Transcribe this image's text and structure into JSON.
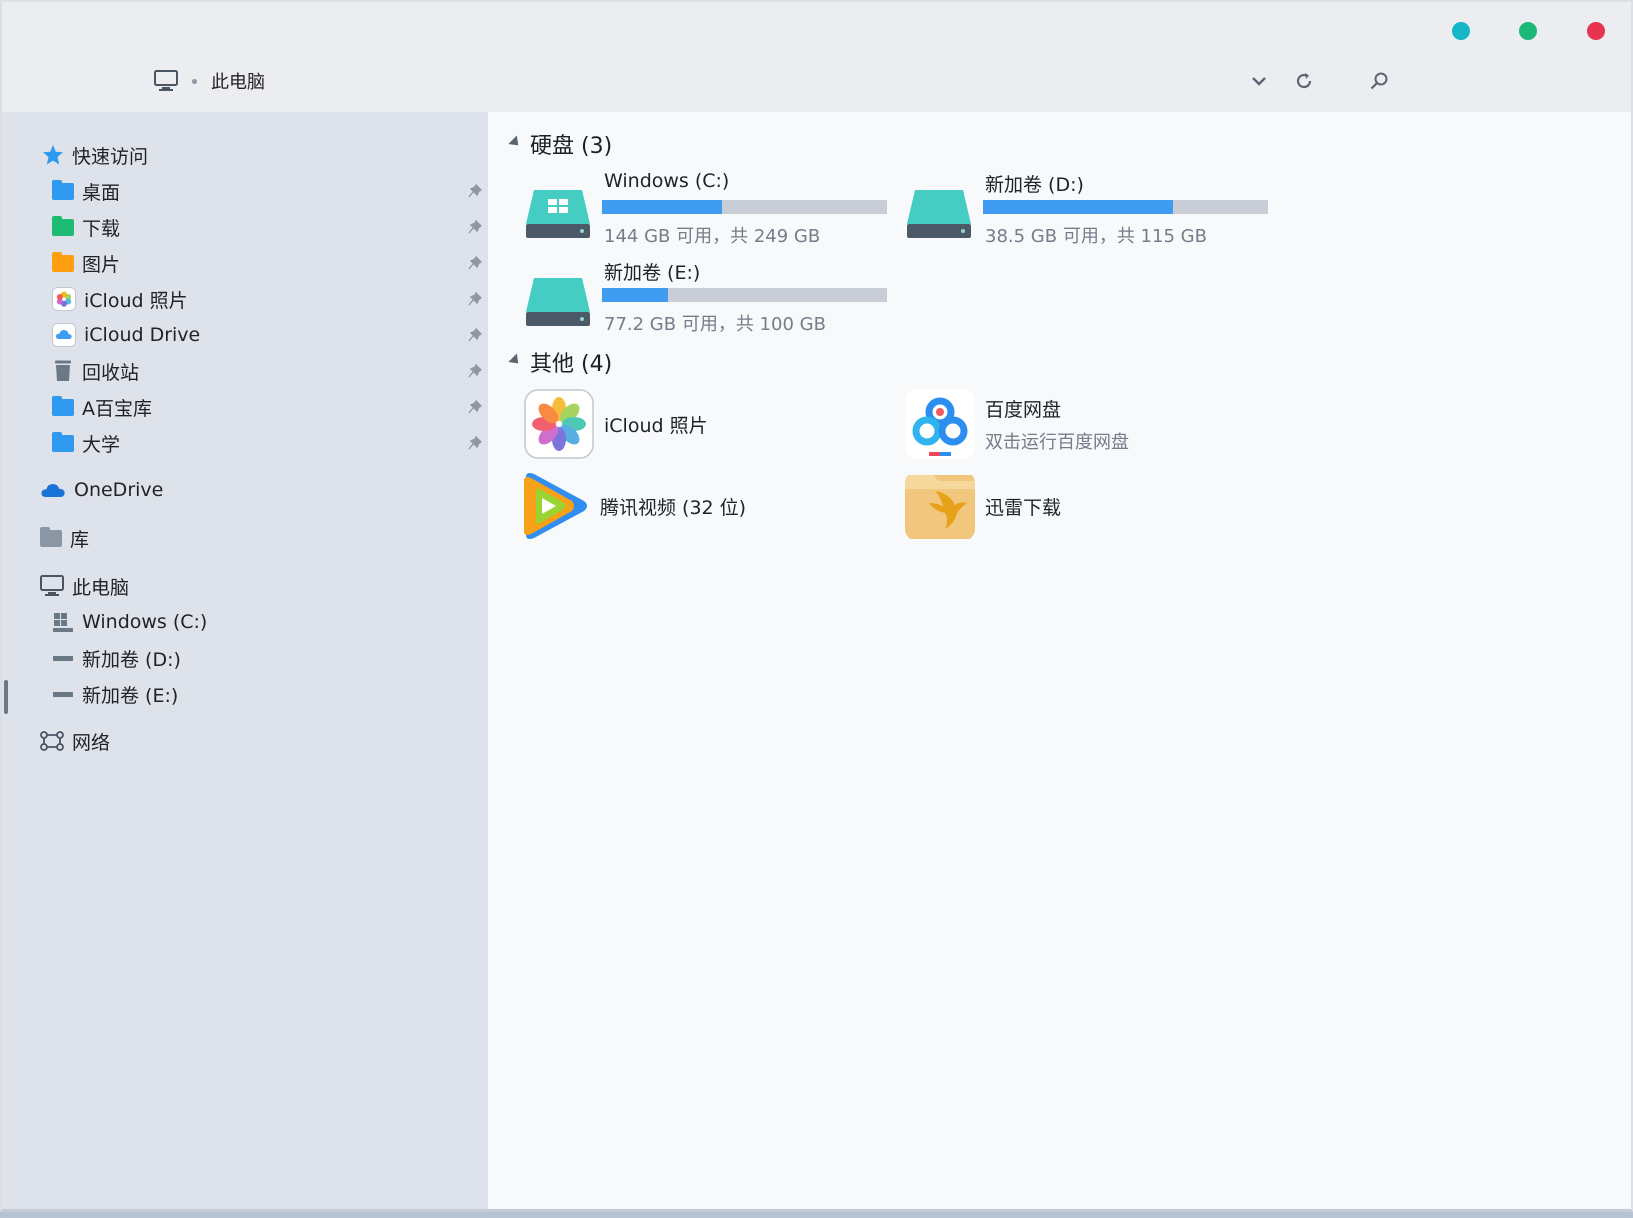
{
  "titlebar": {
    "location_label": "此电脑",
    "buttons": [
      "dropdown",
      "refresh",
      "search"
    ],
    "window_controls": {
      "colors": [
        "#14b6c8",
        "#1cb877",
        "#e8334f"
      ]
    }
  },
  "sidebar": {
    "quick_access": "快速访问",
    "pinned": [
      {
        "label": "桌面",
        "icon": "folder-blue-icon"
      },
      {
        "label": "下载",
        "icon": "folder-green-icon"
      },
      {
        "label": "图片",
        "icon": "folder-orange-icon"
      },
      {
        "label": "iCloud 照片",
        "icon": "icloud-photos-icon"
      },
      {
        "label": "iCloud Drive",
        "icon": "icloud-drive-icon"
      },
      {
        "label": "回收站",
        "icon": "recycle-bin-icon"
      },
      {
        "label": "A百宝库",
        "icon": "folder-blue-icon"
      },
      {
        "label": "大学",
        "icon": "folder-blue-icon"
      }
    ],
    "onedrive": "OneDrive",
    "library": "库",
    "this_pc": "此电脑",
    "drives": [
      "Windows (C:)",
      "新加卷 (D:)",
      "新加卷 (E:)"
    ],
    "network": "网络"
  },
  "main": {
    "drives_header": "硬盘 (3)",
    "drives": [
      {
        "name": "Windows (C:)",
        "usage": "144 GB 可用，共 249 GB",
        "used_fraction": 0.42
      },
      {
        "name": "新加卷 (D:)",
        "usage": "38.5 GB 可用，共 115 GB",
        "used_fraction": 0.665
      },
      {
        "name": "新加卷 (E:)",
        "usage": "77.2 GB 可用，共 100 GB",
        "used_fraction": 0.23
      }
    ],
    "other_header": "其他 (4)",
    "others": [
      {
        "name": "iCloud 照片",
        "sub": ""
      },
      {
        "name": "百度网盘",
        "sub": "双击运行百度网盘"
      },
      {
        "name": "腾讯视频 (32 位)",
        "sub": ""
      },
      {
        "name": "迅雷下载",
        "sub": ""
      }
    ]
  }
}
